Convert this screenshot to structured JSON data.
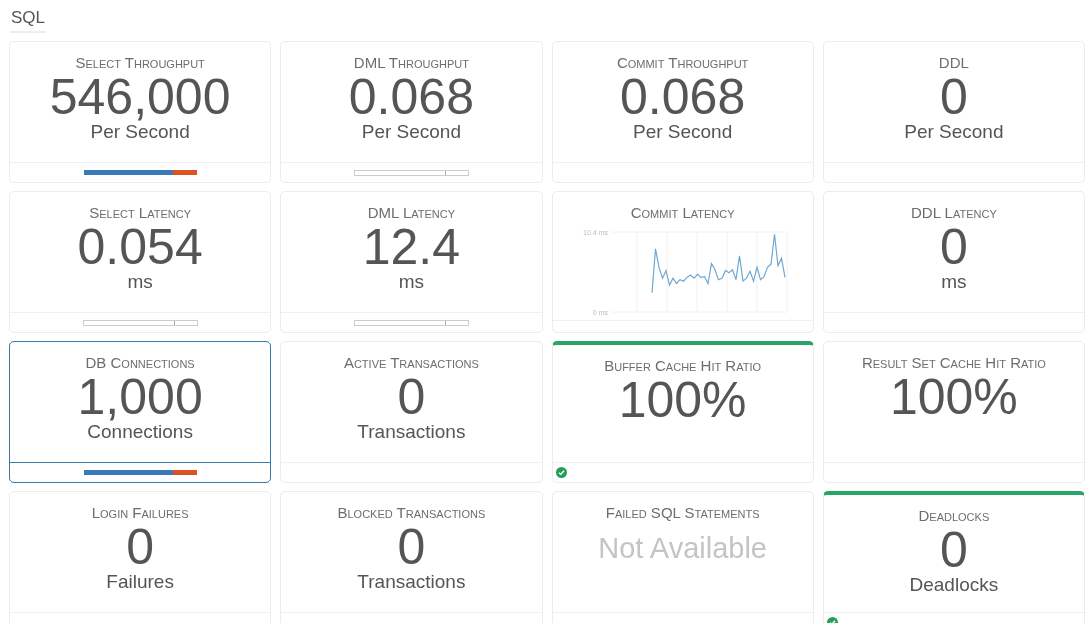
{
  "section": {
    "title": "SQL"
  },
  "tiles": [
    {
      "title": "Select Throughput",
      "value": "546,000",
      "unit": "Per Second",
      "selected": false,
      "healthy": false,
      "footer": {
        "kind": "split",
        "level": 0.79
      }
    },
    {
      "title": "DML Throughput",
      "value": "0.068",
      "unit": "Per Second",
      "selected": false,
      "healthy": false,
      "footer": {
        "kind": "meter",
        "level": 0.8
      }
    },
    {
      "title": "Commit Throughput",
      "value": "0.068",
      "unit": "Per Second",
      "selected": false,
      "healthy": false,
      "footer": {
        "kind": "none"
      }
    },
    {
      "title": "DDL",
      "value": "0",
      "unit": "Per Second",
      "selected": false,
      "healthy": false,
      "footer": {
        "kind": "none"
      }
    },
    {
      "title": "Select Latency",
      "value": "0.054",
      "unit": "ms",
      "selected": false,
      "healthy": false,
      "footer": {
        "kind": "meter",
        "level": 0.8
      }
    },
    {
      "title": "DML Latency",
      "value": "12.4",
      "unit": "ms",
      "selected": false,
      "healthy": false,
      "footer": {
        "kind": "meter",
        "level": 0.8
      }
    },
    {
      "title": "Commit Latency",
      "selected": false,
      "healthy": false,
      "footer": {
        "kind": "none"
      },
      "chart_data": {
        "type": "line",
        "ylim": [
          0,
          10.4
        ],
        "yticks": [
          {
            "value": 10.4,
            "label": "10.4 ms"
          },
          {
            "value": 0,
            "label": "0 ms"
          }
        ],
        "series": [
          {
            "color": "#6fa8d0",
            "values": [
              2.5,
              8.2,
              5.8,
              4.4,
              5.4,
              3.5,
              4.4,
              3.7,
              4.2,
              4.0,
              4.5,
              4.8,
              4.4,
              4.9,
              4.5,
              4.6,
              3.7,
              6.3,
              5.5,
              4.2,
              4.4,
              5.4,
              5.1,
              5.5,
              4.2,
              7.3,
              4.0,
              4.4,
              5.3,
              4.0,
              5.8,
              4.2,
              4.6,
              5.8,
              6.2,
              10.1,
              6.0,
              7.0,
              4.5
            ]
          }
        ]
      }
    },
    {
      "title": "DDL Latency",
      "value": "0",
      "unit": "ms",
      "selected": false,
      "healthy": false,
      "footer": {
        "kind": "none"
      }
    },
    {
      "title": "DB Connections",
      "value": "1,000",
      "unit": "Connections",
      "selected": true,
      "healthy": false,
      "footer": {
        "kind": "split",
        "level": 0.79
      }
    },
    {
      "title": "Active Transactions",
      "value": "0",
      "unit": "Transactions",
      "selected": false,
      "healthy": false,
      "footer": {
        "kind": "none"
      }
    },
    {
      "title": "Buffer Cache Hit Ratio",
      "value": "100%",
      "selected": false,
      "healthy": true,
      "footer": {
        "kind": "ok"
      }
    },
    {
      "title": "Result Set Cache Hit Ratio",
      "value": "100%",
      "selected": false,
      "healthy": false,
      "footer": {
        "kind": "none"
      }
    },
    {
      "title": "Login Failures",
      "value": "0",
      "unit": "Failures",
      "selected": false,
      "healthy": false,
      "footer": {
        "kind": "none"
      }
    },
    {
      "title": "Blocked Transactions",
      "value": "0",
      "unit": "Transactions",
      "selected": false,
      "healthy": false,
      "footer": {
        "kind": "none"
      }
    },
    {
      "title": "Failed SQL Statements",
      "value": "Not Available",
      "muted": true,
      "selected": false,
      "healthy": false,
      "footer": {
        "kind": "none"
      }
    },
    {
      "title": "Deadlocks",
      "value": "0",
      "unit": "Deadlocks",
      "selected": false,
      "healthy": true,
      "footer": {
        "kind": "ok"
      }
    }
  ]
}
